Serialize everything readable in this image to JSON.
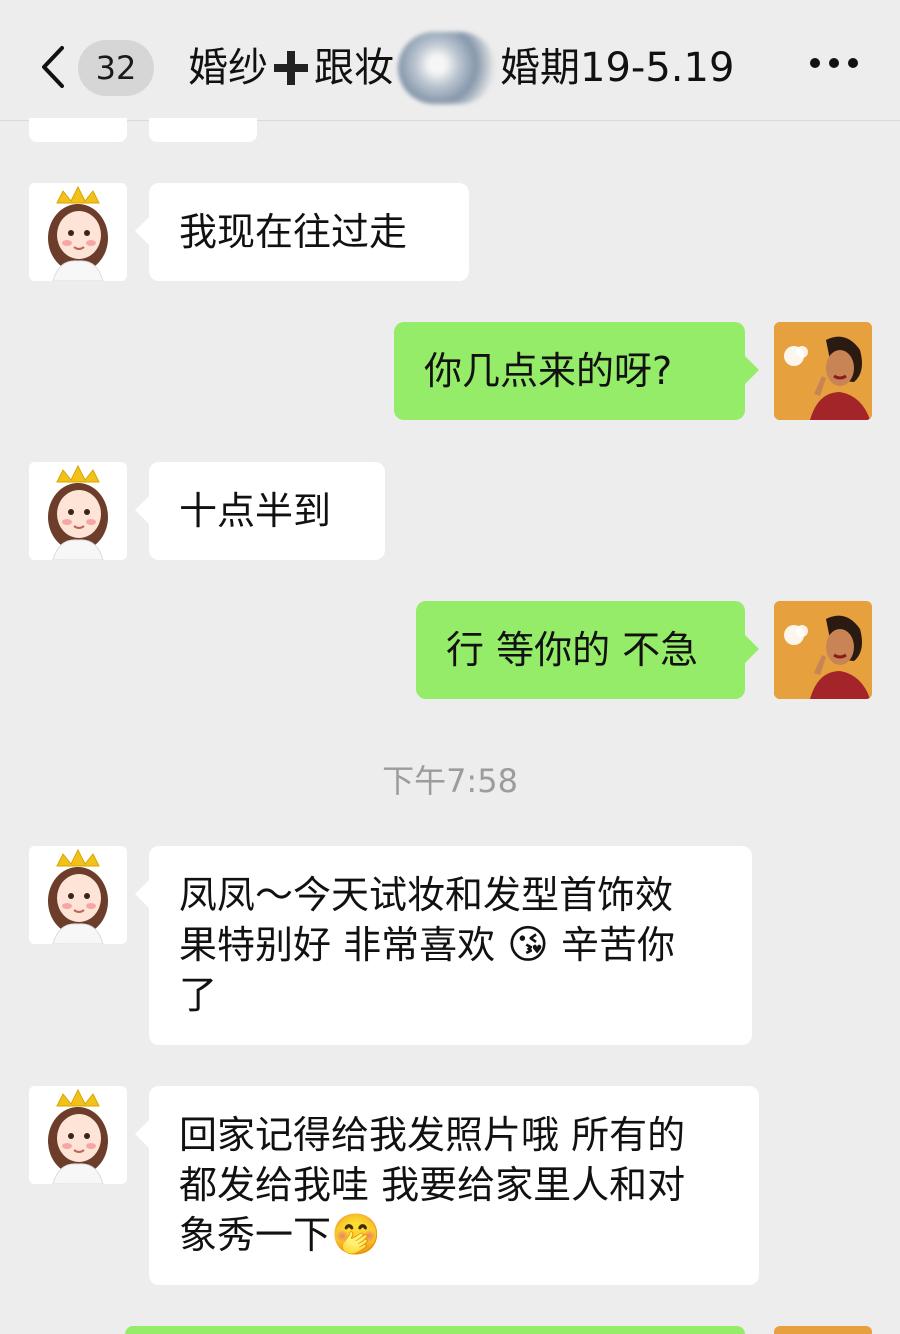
{
  "header": {
    "unread_count": "32",
    "title_part1": "婚纱",
    "title_part2": "跟妆",
    "title_part3": "婚期19-5.19"
  },
  "messages": [
    {
      "side": "left",
      "text": "我现在往过走"
    },
    {
      "side": "right",
      "text": "你几点来的呀?"
    },
    {
      "side": "left",
      "text": "十点半到"
    },
    {
      "side": "right",
      "text": "行 等你的 不急"
    },
    {
      "side": "left",
      "text_line1": "凤凤～今天试妆和发型首饰效",
      "text_line2a": "果特别好 非常喜欢 ",
      "emoji1": "😘",
      "text_line2b": " 辛苦你",
      "text_line3": "了"
    },
    {
      "side": "left",
      "text_line1": "回家记得给我发照片哦 所有的",
      "text_line2": "都发给我哇 我要给家里人和对",
      "text_line3": "象秀一下",
      "emoji2": "🤭"
    }
  ],
  "timestamp": "下午7:58",
  "colors": {
    "background": "#ededed",
    "bubble_left": "#ffffff",
    "bubble_right": "#95ec69",
    "avatar_right_bg": "#e6a13e"
  },
  "icons": {
    "back": "chevron-left-icon",
    "more": "more-dots-icon",
    "plus": "plus-icon",
    "avatar_left": "avatar-cartoon-girl-crown",
    "avatar_right": "avatar-illustrated-woman"
  }
}
